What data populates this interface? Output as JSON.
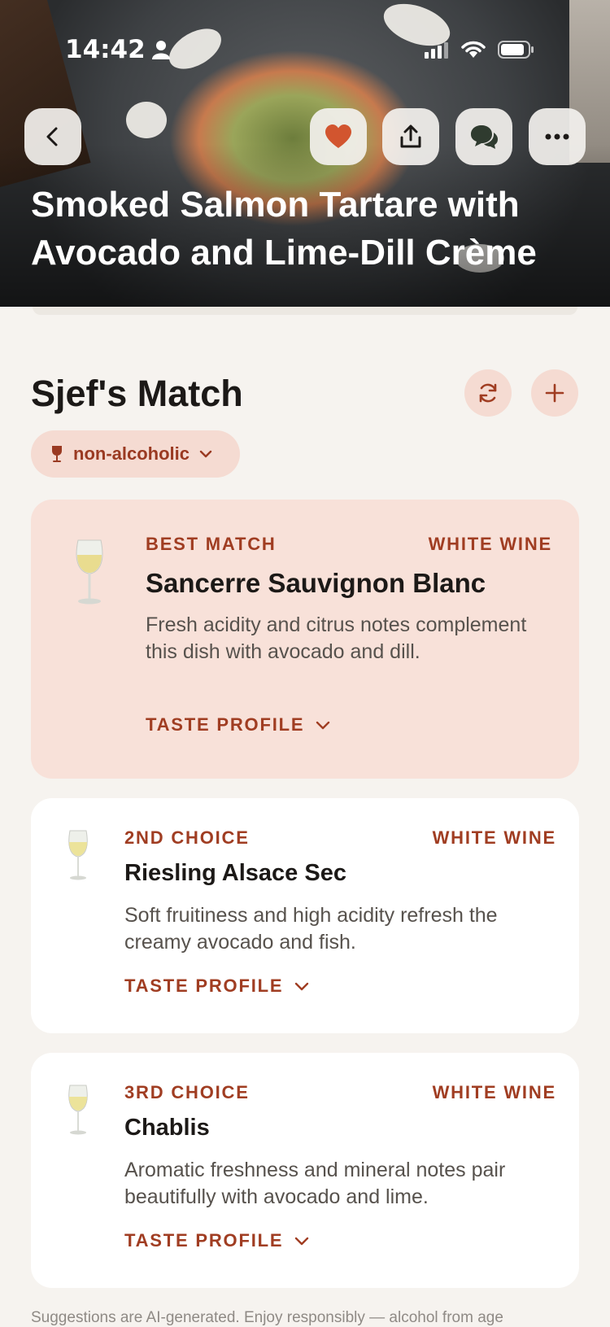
{
  "status_bar": {
    "time": "14:42"
  },
  "recipe": {
    "title": "Smoked Salmon Tartare with Avocado and Lime-Dill Crème"
  },
  "section": {
    "title": "Sjef's Match",
    "filter_label": "non-alcoholic"
  },
  "pairings": [
    {
      "rank": "BEST MATCH",
      "type": "WHITE WINE",
      "name": "Sancerre Sauvignon Blanc",
      "description": "Fresh acidity and citrus notes complement this dish with avocado and dill.",
      "taste_label": "TASTE PROFILE"
    },
    {
      "rank": "2ND CHOICE",
      "type": "WHITE WINE",
      "name": "Riesling Alsace Sec",
      "description": "Soft fruitiness and high acidity refresh the creamy avocado and fish.",
      "taste_label": "TASTE PROFILE"
    },
    {
      "rank": "3RD CHOICE",
      "type": "WHITE WINE",
      "name": "Chablis",
      "description": "Aromatic freshness and mineral notes pair beautifully with avocado and lime.",
      "taste_label": "TASTE PROFILE"
    }
  ],
  "footer": {
    "disclaimer": "Suggestions are AI-generated. Enjoy responsibly — alcohol from age"
  },
  "colors": {
    "accent": "#a03d22",
    "heart": "#d2552f",
    "best_card": "#f8e1d9",
    "chip": "#f5dbd2"
  },
  "icons": [
    "back-icon",
    "heart-icon",
    "share-icon",
    "chat-icon",
    "more-icon",
    "refresh-icon",
    "plus-icon",
    "glass-icon",
    "chevron-down-icon"
  ]
}
